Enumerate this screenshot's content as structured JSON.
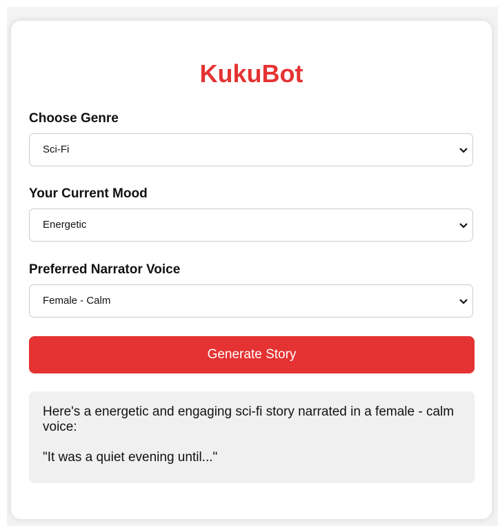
{
  "app": {
    "title": "KukuBot",
    "accent": "#e53333"
  },
  "genre": {
    "label": "Choose Genre",
    "selected": "Sci-Fi"
  },
  "mood": {
    "label": "Your Current Mood",
    "selected": "Energetic"
  },
  "voice": {
    "label": "Preferred Narrator Voice",
    "selected": "Female - Calm"
  },
  "actions": {
    "generate_label": "Generate Story"
  },
  "output": {
    "intro": "Here's a energetic and engaging sci-fi story narrated in a female - calm voice:",
    "story": "\"It was a quiet evening until...\""
  },
  "icons": {
    "select_arrow": "chevron-down-icon"
  }
}
